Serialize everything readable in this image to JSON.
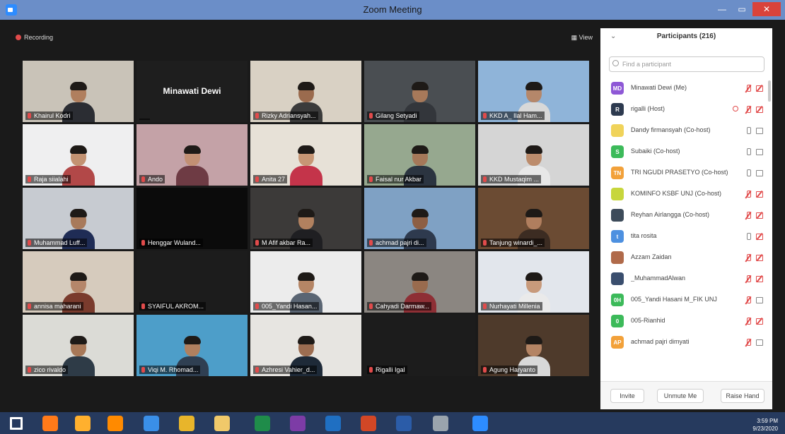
{
  "window": {
    "title": "Zoom Meeting"
  },
  "toolbar": {
    "recording_label": "Recording",
    "view_label": "View"
  },
  "tiles": [
    {
      "name": "Khairul Kodri",
      "bg": "#c9c3b8",
      "skin": "#b07f5e",
      "shirt": "#2b2d33"
    },
    {
      "name": "",
      "bg": "#1e1e1e",
      "big": "Minawati Dewi"
    },
    {
      "name": "Rizky Adriansyah...",
      "bg": "#d9d1c4",
      "skin": "#9b6b4e",
      "shirt": "#3b3b3b"
    },
    {
      "name": "Gilang Setyadi",
      "bg": "#4a4e52",
      "skin": "#a7795a",
      "shirt": "#33363b"
    },
    {
      "name": "KKD A_ Ilal Ham...",
      "bg": "#8fb4d9",
      "skin": "#b5876a",
      "shirt": "#d8d8d8"
    },
    {
      "name": "Raja siialahi",
      "bg": "#efeff0",
      "skin": "#c39272",
      "shirt": "#b24848"
    },
    {
      "name": "Ando",
      "bg": "#c4a2a7",
      "skin": "#c29074",
      "shirt": "#6e3b44"
    },
    {
      "name": "Anita 27",
      "bg": "#e7e1d7",
      "skin": "#c79675",
      "shirt": "#c4344a"
    },
    {
      "name": "Faisal nur Akbar",
      "bg": "#96a88f",
      "skin": "#a57859",
      "shirt": "#2b3440"
    },
    {
      "name": "KKD Mustaqim ...",
      "bg": "#d5d5d5",
      "skin": "#bc8c6c",
      "shirt": "#e7e7e7"
    },
    {
      "name": "Muhammad Luff...",
      "bg": "#c7cbd1",
      "skin": "#a87a5b",
      "shirt": "#1f2c55"
    },
    {
      "name": "Henggar Wuland...",
      "bg": "#0b0b0b"
    },
    {
      "name": "M Afif akbar Ra...",
      "bg": "#3c3a39",
      "skin": "#b1815f",
      "shirt": "#1f1f22"
    },
    {
      "name": "achmad pajri di...",
      "bg": "#7fa1c4",
      "skin": "#8d5f44",
      "shirt": "#2e3a4e"
    },
    {
      "name": "Tanjung winardi_...",
      "bg": "#6b4b33",
      "skin": "#b07e5e",
      "shirt": "#3c2c22"
    },
    {
      "name": "annisa maharani",
      "bg": "#d6cbbd",
      "skin": "#b5866a",
      "shirt": "#7a3b2d"
    },
    {
      "name": "SYAIFUL AKROM...",
      "bg": "#1c1c1c"
    },
    {
      "name": "005_Yandi Hasan...",
      "bg": "#ececec",
      "skin": "#b58565",
      "shirt": "#5a6573"
    },
    {
      "name": "Cahyadi Darmaw...",
      "bg": "#8b8681",
      "skin": "#996b4e",
      "shirt": "#8e2f35"
    },
    {
      "name": "Nurhayati Millenia",
      "bg": "#e2e6ec",
      "skin": "#c89a7b",
      "shirt": "#eaeaea"
    },
    {
      "name": "zico rivaldo",
      "bg": "#dbdbd6",
      "skin": "#a77858",
      "shirt": "#2e3b47"
    },
    {
      "name": "Viqi M. Rhomad...",
      "bg": "#4d9ec9",
      "skin": "#b0805f",
      "shirt": "#2f3f52"
    },
    {
      "name": "Azhresi Vahier_d...",
      "bg": "#e7e5e1",
      "skin": "#9c6d51",
      "shirt": "#1e2a38"
    },
    {
      "name": "Rigalli Igal",
      "bg": "#1c1c1c"
    },
    {
      "name": "Agung Haryanto",
      "bg": "#4e3a2b",
      "skin": "#b48464",
      "shirt": "#d8d8d8"
    }
  ],
  "participants": {
    "header": "Participants (216)",
    "search_placeholder": "Find a participant",
    "list": [
      {
        "initials": "MD",
        "color": "#8e58d6",
        "name": "Minawati Dewi (Me)",
        "mic": "muted",
        "cam": "off"
      },
      {
        "initials": "R",
        "color": "#2d3a4f",
        "name": "rigalli (Host)",
        "mic": "muted",
        "cam": "off",
        "host": true
      },
      {
        "initials": "",
        "color": "#f0d35a",
        "name": "Dandy firmansyah (Co-host)",
        "mic": "on",
        "cam": "on"
      },
      {
        "initials": "S",
        "color": "#3cba5a",
        "name": "Subaiki (Co-host)",
        "mic": "on",
        "cam": "on"
      },
      {
        "initials": "TN",
        "color": "#f2a13a",
        "name": "TRI NGUDI PRASETYO (Co-host)",
        "mic": "on",
        "cam": "on"
      },
      {
        "initials": "",
        "color": "#c7d63c",
        "name": "KOMINFO KSBF UNJ (Co-host)",
        "mic": "muted",
        "cam": "off"
      },
      {
        "initials": "",
        "color": "#3d4b5a",
        "name": "Reyhan Airlangga (Co-host)",
        "mic": "muted",
        "cam": "off"
      },
      {
        "initials": "t",
        "color": "#4d90e0",
        "name": "tita rosita",
        "mic": "on",
        "cam": "off"
      },
      {
        "initials": "",
        "color": "#b06a4a",
        "name": "Azzam Zaidan",
        "mic": "muted",
        "cam": "off"
      },
      {
        "initials": "",
        "color": "#3a4e6e",
        "name": "_MuhammadAlwan",
        "mic": "muted",
        "cam": "off"
      },
      {
        "initials": "0H",
        "color": "#3cba5a",
        "name": "005_Yandi Hasani M_FIK UNJ",
        "mic": "muted",
        "cam": "on"
      },
      {
        "initials": "0",
        "color": "#3cba5a",
        "name": "005-Rianhid",
        "mic": "muted",
        "cam": "off"
      },
      {
        "initials": "AP",
        "color": "#f2a13a",
        "name": "achmad pajri dimyati",
        "mic": "muted",
        "cam": "on"
      }
    ],
    "footer": {
      "invite": "Invite",
      "unmute": "Unmute Me",
      "raise_hand": "Raise Hand"
    }
  },
  "taskbar": {
    "icons": [
      {
        "name": "windows-start-icon",
        "color": "#ffffff"
      },
      {
        "name": "firefox-icon",
        "color": "#ff7a1a"
      },
      {
        "name": "opera-icon",
        "color": "#ffb02e"
      },
      {
        "name": "vlc-icon",
        "color": "#ff8a00"
      },
      {
        "name": "ie-icon",
        "color": "#3a8fe8"
      },
      {
        "name": "chrome-icon",
        "color": "#e8b52b"
      },
      {
        "name": "file-explorer-icon",
        "color": "#f0c96a"
      },
      {
        "name": "excel-icon",
        "color": "#1f8c4a"
      },
      {
        "name": "onenote-icon",
        "color": "#7d3ca6"
      },
      {
        "name": "outlook-icon",
        "color": "#1f6fc2"
      },
      {
        "name": "powerpoint-icon",
        "color": "#d24726"
      },
      {
        "name": "word-icon",
        "color": "#2b5ca8"
      },
      {
        "name": "paint-icon",
        "color": "#9aa4ad"
      },
      {
        "name": "zoom-icon",
        "color": "#2d8cff"
      }
    ],
    "time": "3:59 PM",
    "date": "9/23/2020"
  }
}
